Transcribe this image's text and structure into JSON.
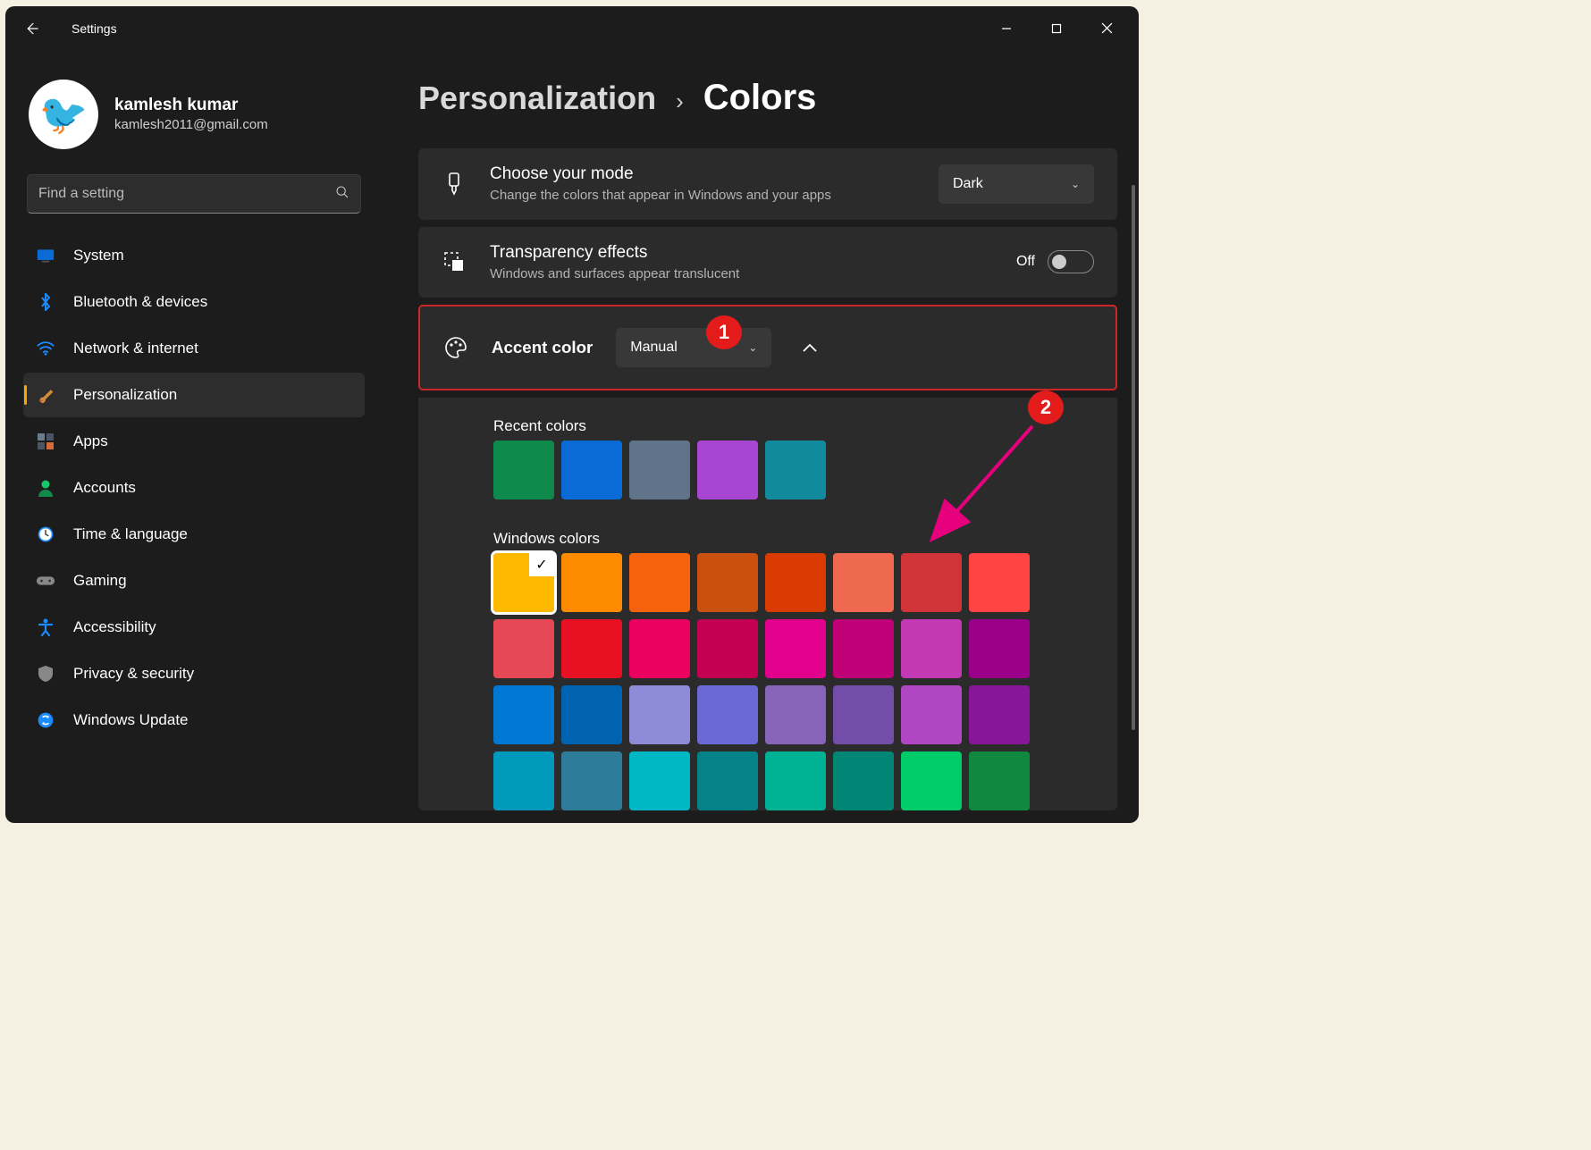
{
  "window": {
    "title": "Settings"
  },
  "user": {
    "name": "kamlesh kumar",
    "email": "kamlesh2011@gmail.com"
  },
  "search": {
    "placeholder": "Find a setting"
  },
  "nav": [
    {
      "label": "System",
      "icon": "🖥️",
      "selected": false
    },
    {
      "label": "Bluetooth & devices",
      "icon": "bt",
      "selected": false
    },
    {
      "label": "Network & internet",
      "icon": "wifi",
      "selected": false
    },
    {
      "label": "Personalization",
      "icon": "brush",
      "selected": true
    },
    {
      "label": "Apps",
      "icon": "apps",
      "selected": false
    },
    {
      "label": "Accounts",
      "icon": "person",
      "selected": false
    },
    {
      "label": "Time & language",
      "icon": "clock",
      "selected": false
    },
    {
      "label": "Gaming",
      "icon": "game",
      "selected": false
    },
    {
      "label": "Accessibility",
      "icon": "a11y",
      "selected": false
    },
    {
      "label": "Privacy & security",
      "icon": "shield",
      "selected": false
    },
    {
      "label": "Windows Update",
      "icon": "update",
      "selected": false
    }
  ],
  "breadcrumb": {
    "parent": "Personalization",
    "current": "Colors"
  },
  "mode": {
    "title": "Choose your mode",
    "desc": "Change the colors that appear in Windows and your apps",
    "value": "Dark"
  },
  "transparency": {
    "title": "Transparency effects",
    "desc": "Windows and surfaces appear translucent",
    "state_label": "Off",
    "enabled": false
  },
  "accent": {
    "title": "Accent color",
    "value": "Manual",
    "recent_title": "Recent colors",
    "recent": [
      "#0d8a4b",
      "#0a6bd6",
      "#5f7489",
      "#a646d1",
      "#108a9c"
    ],
    "windows_title": "Windows colors",
    "windows": [
      {
        "c": "#ffb900",
        "sel": true
      },
      {
        "c": "#ff8c00"
      },
      {
        "c": "#f7630c"
      },
      {
        "c": "#ca5010"
      },
      {
        "c": "#da3b01"
      },
      {
        "c": "#ef6950"
      },
      {
        "c": "#d13438"
      },
      {
        "c": "#ff4343"
      },
      {
        "c": "#e74856"
      },
      {
        "c": "#e81123"
      },
      {
        "c": "#ea005e"
      },
      {
        "c": "#c30052"
      },
      {
        "c": "#e3008c"
      },
      {
        "c": "#bf0077"
      },
      {
        "c": "#c239b3"
      },
      {
        "c": "#9a0089"
      },
      {
        "c": "#0078d4"
      },
      {
        "c": "#0063b1"
      },
      {
        "c": "#8e8cd8"
      },
      {
        "c": "#6b69d6"
      },
      {
        "c": "#8764b8"
      },
      {
        "c": "#744da9"
      },
      {
        "c": "#b146c2"
      },
      {
        "c": "#881798"
      },
      {
        "c": "#0099bc"
      },
      {
        "c": "#2d7d9a"
      },
      {
        "c": "#00b7c3"
      },
      {
        "c": "#038387"
      },
      {
        "c": "#00b294"
      },
      {
        "c": "#018574"
      },
      {
        "c": "#00cc6a"
      },
      {
        "c": "#10893e"
      }
    ]
  },
  "annotations": {
    "one": "1",
    "two": "2"
  }
}
